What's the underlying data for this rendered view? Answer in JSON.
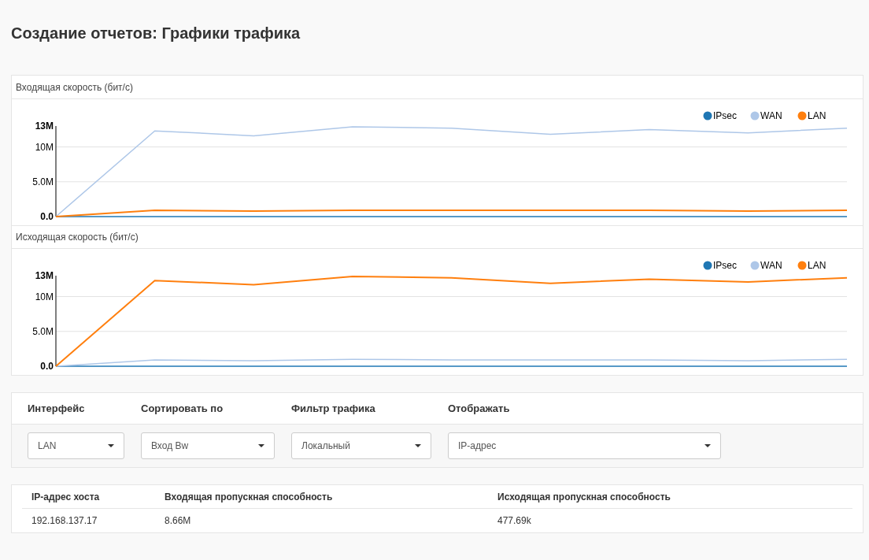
{
  "page_title": "Создание отчетов: Графики трафика",
  "charts": [
    {
      "title": "Входящая скорость (бит/с)",
      "chart_data": {
        "type": "line",
        "legend": true,
        "ylim": [
          0,
          13
        ],
        "yticks": [
          {
            "value": 0,
            "label": "0.0"
          },
          {
            "value": 5,
            "label": "5.0M"
          },
          {
            "value": 10,
            "label": "10M"
          },
          {
            "value": 13,
            "label": "13M"
          }
        ],
        "series": [
          {
            "name": "IPsec",
            "color": "#1f77b4",
            "values": [
              0,
              0,
              0,
              0,
              0,
              0,
              0,
              0,
              0
            ]
          },
          {
            "name": "WAN",
            "color": "#aec7e8",
            "values": [
              0,
              12.3,
              11.6,
              12.9,
              12.7,
              11.8,
              12.5,
              12.0,
              12.7
            ]
          },
          {
            "name": "LAN",
            "color": "#ff7f0e",
            "values": [
              0,
              0.9,
              0.8,
              0.9,
              0.9,
              0.9,
              0.9,
              0.8,
              0.9
            ]
          }
        ]
      }
    },
    {
      "title": "Исходящая скорость (бит/с)",
      "chart_data": {
        "type": "line",
        "legend": true,
        "ylim": [
          0,
          13
        ],
        "yticks": [
          {
            "value": 0,
            "label": "0.0"
          },
          {
            "value": 5,
            "label": "5.0M"
          },
          {
            "value": 10,
            "label": "10M"
          },
          {
            "value": 13,
            "label": "13M"
          }
        ],
        "series": [
          {
            "name": "IPsec",
            "color": "#1f77b4",
            "values": [
              0,
              0,
              0,
              0,
              0,
              0,
              0,
              0,
              0
            ]
          },
          {
            "name": "WAN",
            "color": "#aec7e8",
            "values": [
              0,
              0.9,
              0.8,
              1.0,
              0.9,
              0.9,
              0.9,
              0.8,
              1.0
            ]
          },
          {
            "name": "LAN",
            "color": "#ff7f0e",
            "values": [
              0,
              12.3,
              11.7,
              12.9,
              12.7,
              11.9,
              12.5,
              12.1,
              12.7
            ]
          }
        ]
      }
    }
  ],
  "filters": [
    {
      "label": "Интерфейс",
      "value": "LAN"
    },
    {
      "label": "Сортировать по",
      "value": "Вход Bw"
    },
    {
      "label": "Фильтр трафика",
      "value": "Локальный"
    },
    {
      "label": "Отображать",
      "value": "IP-адрес"
    }
  ],
  "table": {
    "columns": [
      "IP-адрес хоста",
      "Входящая пропускная способность",
      "Исходящая пропускная способность"
    ],
    "rows": [
      [
        "192.168.137.17",
        "8.66M",
        "477.69k"
      ]
    ]
  }
}
